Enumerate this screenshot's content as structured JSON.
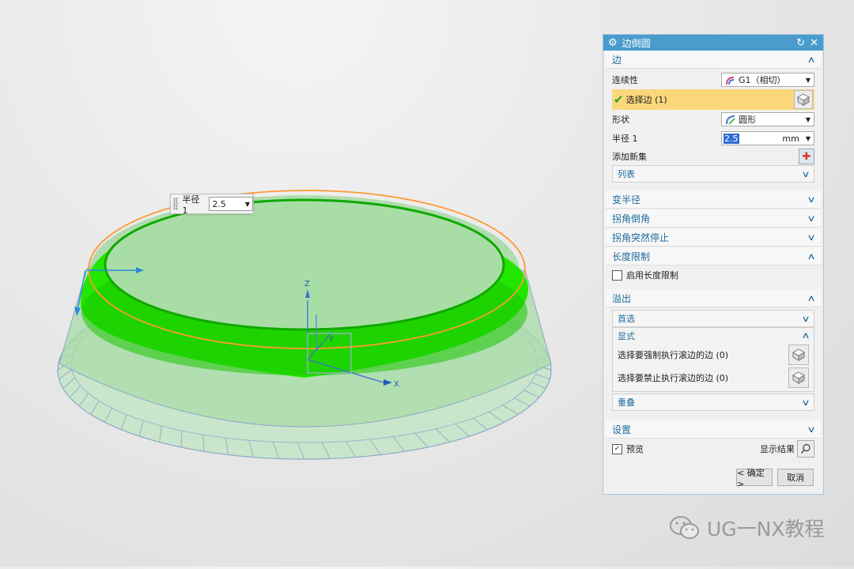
{
  "viewport": {
    "radius_label": "半径 1",
    "radius_value": "2.5",
    "axis_z": "Z",
    "axis_y": "Y",
    "axis_x": "X",
    "fillet_color": "#22e600",
    "edge_color": "#ff9933"
  },
  "dialog": {
    "title": "边倒圆",
    "section_edge": {
      "header": "边",
      "continuity_label": "连续性",
      "continuity_value": "G1（相切）",
      "select_edge_label": "选择边 (1)",
      "shape_label": "形状",
      "shape_value": "圆形",
      "radius_label": "半径 1",
      "radius_value": "2.5",
      "radius_unit": "mm",
      "add_new_set_label": "添加新集",
      "list_label": "列表"
    },
    "section_variable_radius": "变半径",
    "section_corner_setback": "拐角倒角",
    "section_corner_stop": "拐角突然停止",
    "section_length_limit": {
      "header": "长度限制",
      "enable_label": "启用长度限制",
      "enabled": false
    },
    "section_overflow": {
      "header": "溢出",
      "preferred": "首选",
      "explicit": "显式",
      "force_roll_label": "选择要强制执行滚边的边 (0)",
      "prevent_roll_label": "选择要禁止执行滚边的边 (0)",
      "overlap": "重叠"
    },
    "section_settings": "设置",
    "preview_label": "预览",
    "preview_checked": true,
    "show_result_label": "显示结果",
    "ok_label": "< 确定 >",
    "cancel_label": "取消",
    "accent_color": "#4a9ccd",
    "selection_color": "#fbd77c"
  },
  "watermark": {
    "text": "UG一NX教程"
  }
}
